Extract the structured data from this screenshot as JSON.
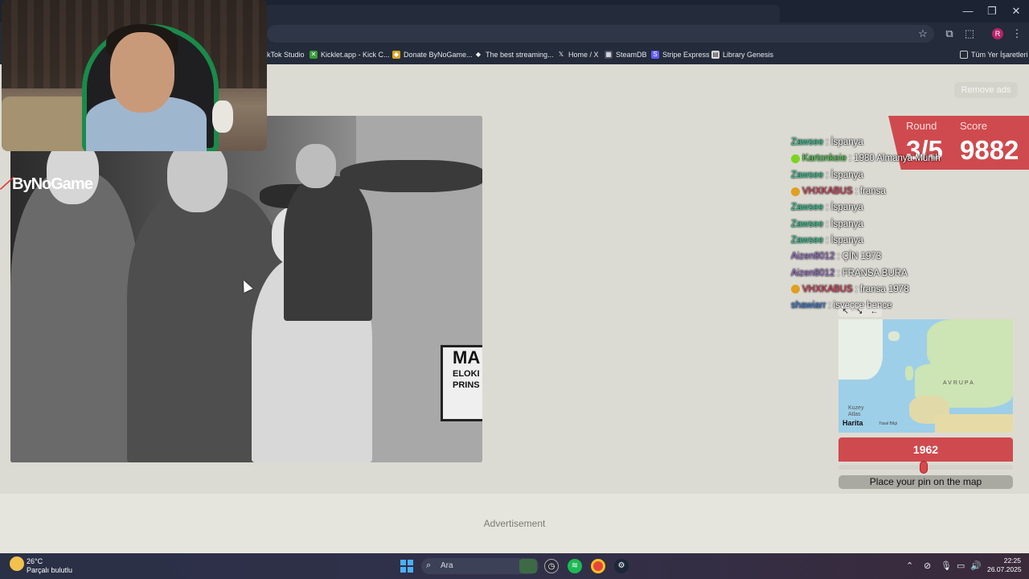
{
  "browser": {
    "bookmarks": [
      {
        "label": "ikTok Studio",
        "icon": "tiktok-icon"
      },
      {
        "label": "Kicklet.app - Kick C...",
        "icon": "kicklet-icon"
      },
      {
        "label": "Donate ByNoGame...",
        "icon": "bynogame-icon"
      },
      {
        "label": "The best streaming...",
        "icon": "diamond-icon"
      },
      {
        "label": "Home / X",
        "icon": "x-icon"
      },
      {
        "label": "SteamDB",
        "icon": "steamdb-icon"
      },
      {
        "label": "Stripe Express",
        "icon": "stripe-icon"
      },
      {
        "label": "Library Genesis",
        "icon": "book-icon"
      }
    ],
    "all_bookmarks_label": "Tüm Yer İşaretleri",
    "profile_initial": "R"
  },
  "page": {
    "remove_ads": "Remove ads",
    "watermark": "ByNoGame",
    "photo_sign_line1": "MA",
    "photo_sign_line2": "ELOKI",
    "photo_sign_line3": "PRINS",
    "advertisement": "Advertisement"
  },
  "game": {
    "round_label": "Round",
    "round_value": "3/5",
    "score_label": "Score",
    "score_value": "9882",
    "year": "1962",
    "year_slider_fraction": 0.49,
    "pin_button": "Place your pin on the map",
    "map": {
      "region_label": "AVRUPA",
      "ocean_label_1": "Kuzey",
      "ocean_label_2": "Atlas",
      "logo": "Harita",
      "legal": "Yasal Bilgi"
    }
  },
  "chat": [
    {
      "user": "Zawsee",
      "color": "#2fd39a",
      "message": "İspanya",
      "badge": ""
    },
    {
      "user": "Kartonkeie",
      "color": "#48d24a",
      "message": "1980 Almanya Münih",
      "badge": "#7ed321"
    },
    {
      "user": "Zawsee",
      "color": "#2fd39a",
      "message": "İspanya",
      "badge": ""
    },
    {
      "user": "VHXKABUS",
      "color": "#e03a5a",
      "message": "fransa",
      "badge": "#e0a020"
    },
    {
      "user": "Zawsee",
      "color": "#2fd39a",
      "message": "İspanya",
      "badge": ""
    },
    {
      "user": "Zawsee",
      "color": "#2fd39a",
      "message": "İspanya",
      "badge": ""
    },
    {
      "user": "Zawsee",
      "color": "#2fd39a",
      "message": "İspanya",
      "badge": ""
    },
    {
      "user": "Aizen8012",
      "color": "#9b6fd6",
      "message": "ÇİN 1973",
      "badge": ""
    },
    {
      "user": "Aizen8012",
      "color": "#9b6fd6",
      "message": "FRANSA BURA",
      "badge": ""
    },
    {
      "user": "VHXKABUS",
      "color": "#e03a5a",
      "message": "fransa 1978",
      "badge": "#e0a020"
    },
    {
      "user": "shawiarr",
      "color": "#3b7fe0",
      "message": "isveççe bence",
      "badge": ""
    }
  ],
  "taskbar": {
    "weather_temp": "26°C",
    "weather_desc": "Parçalı bulutlu",
    "search_placeholder": "Ara",
    "time": "22:25",
    "date": "26.07.2025"
  },
  "colors": {
    "accent": "#cf4a4e",
    "page_bg": "#dcdbd3"
  }
}
